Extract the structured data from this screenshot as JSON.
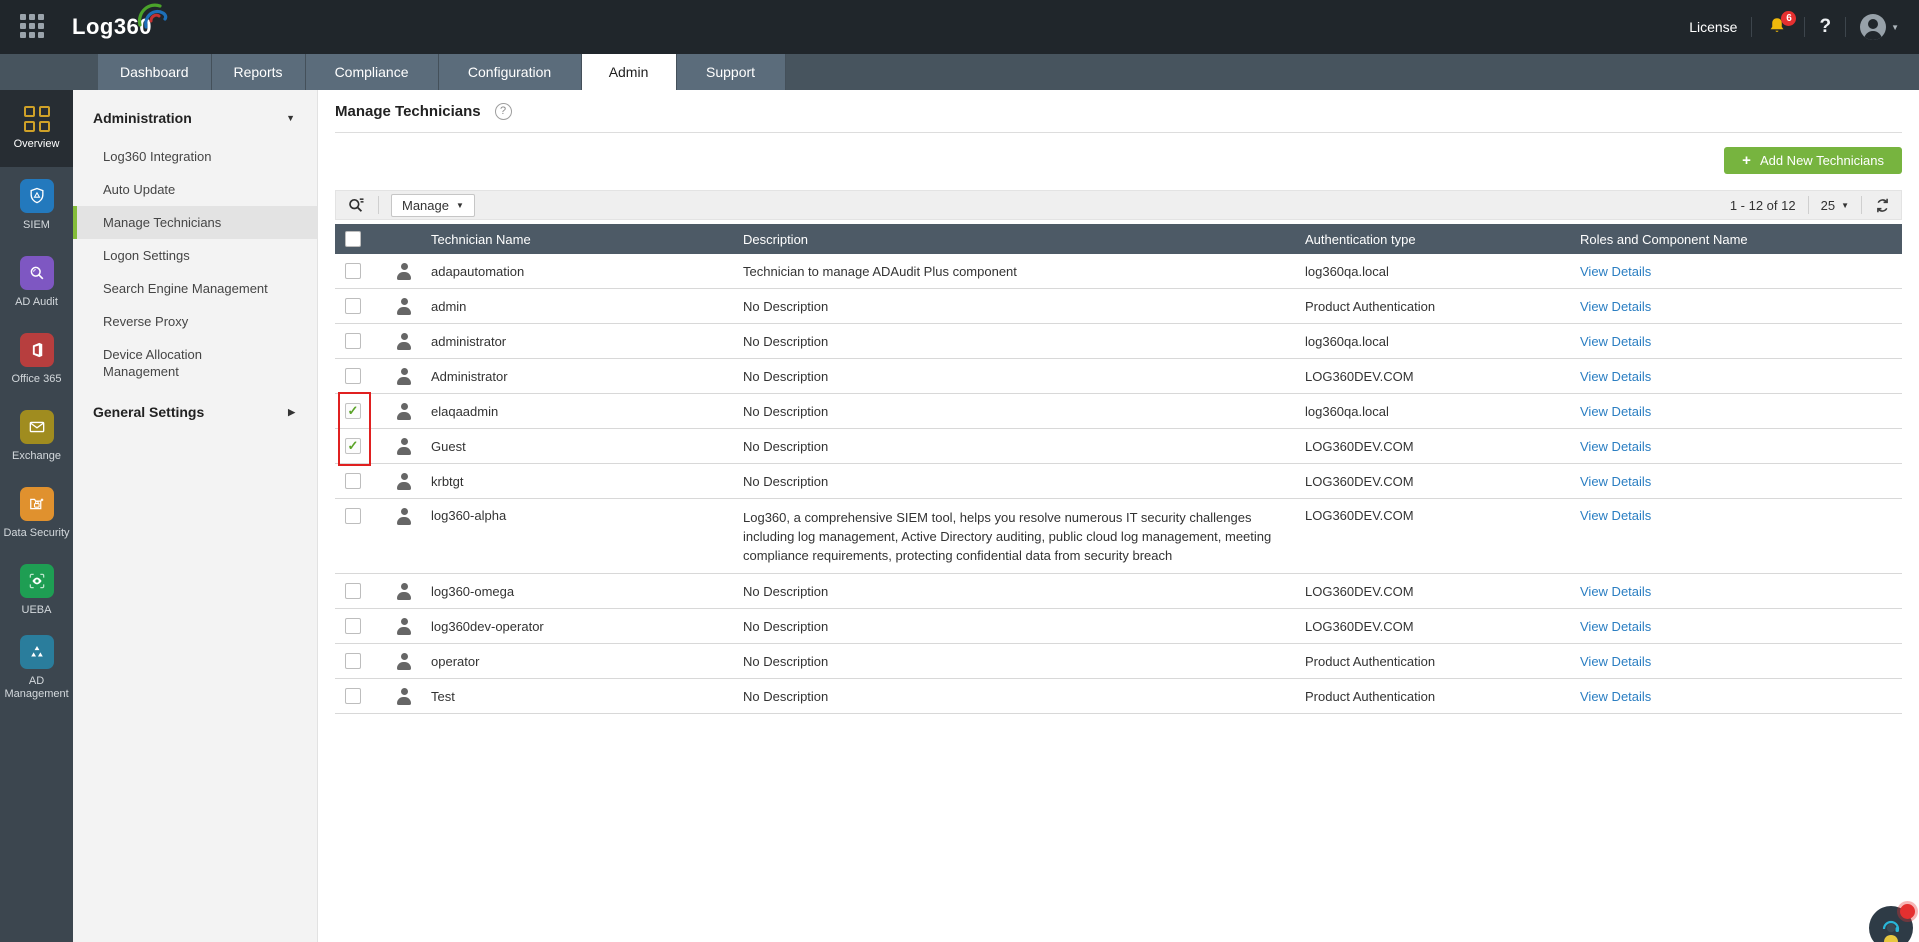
{
  "topbar": {
    "logo_text": "Log360",
    "license_label": "License",
    "notification_count": "6",
    "help_label": "?"
  },
  "tabs": [
    {
      "label": "Dashboard",
      "active": false
    },
    {
      "label": "Reports",
      "active": false
    },
    {
      "label": "Compliance",
      "active": false
    },
    {
      "label": "Configuration",
      "active": false
    },
    {
      "label": "Admin",
      "active": true
    },
    {
      "label": "Support",
      "active": false
    }
  ],
  "sidebar": {
    "items": [
      {
        "label": "Overview",
        "icon": "overview-grid-icon",
        "active": true
      },
      {
        "label": "SIEM",
        "icon": "shield-icon",
        "color": "#2379bd"
      },
      {
        "label": "AD Audit",
        "icon": "magnifier-icon",
        "color": "#7e57c2"
      },
      {
        "label": "Office 365",
        "icon": "office-icon",
        "color": "#b73e3e"
      },
      {
        "label": "Exchange",
        "icon": "envelope-icon",
        "color": "#a08c1f"
      },
      {
        "label": "Data Security",
        "icon": "folder-lock-icon",
        "color": "#e0912e"
      },
      {
        "label": "UEBA",
        "icon": "eye-scan-icon",
        "color": "#1e9e53"
      },
      {
        "label": "AD Management",
        "icon": "triangles-icon",
        "color": "#2a7d9c"
      }
    ]
  },
  "menu": {
    "header": "Administration",
    "items": [
      "Log360 Integration",
      "Auto Update",
      "Manage Technicians",
      "Logon Settings",
      "Search Engine Management",
      "Reverse Proxy",
      "Device Allocation Management"
    ],
    "selected_index": 2,
    "section2": "General Settings"
  },
  "main": {
    "title": "Manage Technicians",
    "add_button_label": "Add New Technicians",
    "manage_label": "Manage",
    "pagination": "1 - 12 of 12",
    "page_size": "25",
    "table": {
      "headers": [
        "Technician Name",
        "Description",
        "Authentication type",
        "Roles and Component Name"
      ],
      "view_details_label": "View Details",
      "rows": [
        {
          "name": "adapautomation",
          "description": "Technician to manage ADAudit Plus component",
          "auth": "log360qa.local",
          "checked": false
        },
        {
          "name": "admin",
          "description": "No Description",
          "auth": "Product Authentication",
          "checked": false
        },
        {
          "name": "administrator",
          "description": "No Description",
          "auth": "log360qa.local",
          "checked": false
        },
        {
          "name": "Administrator",
          "description": "No Description",
          "auth": "LOG360DEV.COM",
          "checked": false
        },
        {
          "name": "elaqaadmin",
          "description": "No Description",
          "auth": "log360qa.local",
          "checked": true,
          "highlighted": true
        },
        {
          "name": "Guest",
          "description": "No Description",
          "auth": "LOG360DEV.COM",
          "checked": true,
          "highlighted": true
        },
        {
          "name": "krbtgt",
          "description": "No Description",
          "auth": "LOG360DEV.COM",
          "checked": false
        },
        {
          "name": "log360-alpha",
          "description": "Log360, a comprehensive SIEM tool, helps you resolve numerous IT security challenges including log management, Active Directory auditing, public cloud log management, meeting compliance requirements, protecting confidential data from security breach",
          "auth": "LOG360DEV.COM",
          "checked": false
        },
        {
          "name": "log360-omega",
          "description": "No Description",
          "auth": "LOG360DEV.COM",
          "checked": false
        },
        {
          "name": "log360dev-operator",
          "description": "No Description",
          "auth": "LOG360DEV.COM",
          "checked": false
        },
        {
          "name": "operator",
          "description": "No Description",
          "auth": "Product Authentication",
          "checked": false
        },
        {
          "name": "Test",
          "description": "No Description",
          "auth": "Product Authentication",
          "checked": false
        }
      ]
    }
  },
  "colors": {
    "accent_green": "#77b43f",
    "link_blue": "#2a7ec2",
    "highlight_red": "#e02020",
    "table_header": "#4d5a66"
  }
}
